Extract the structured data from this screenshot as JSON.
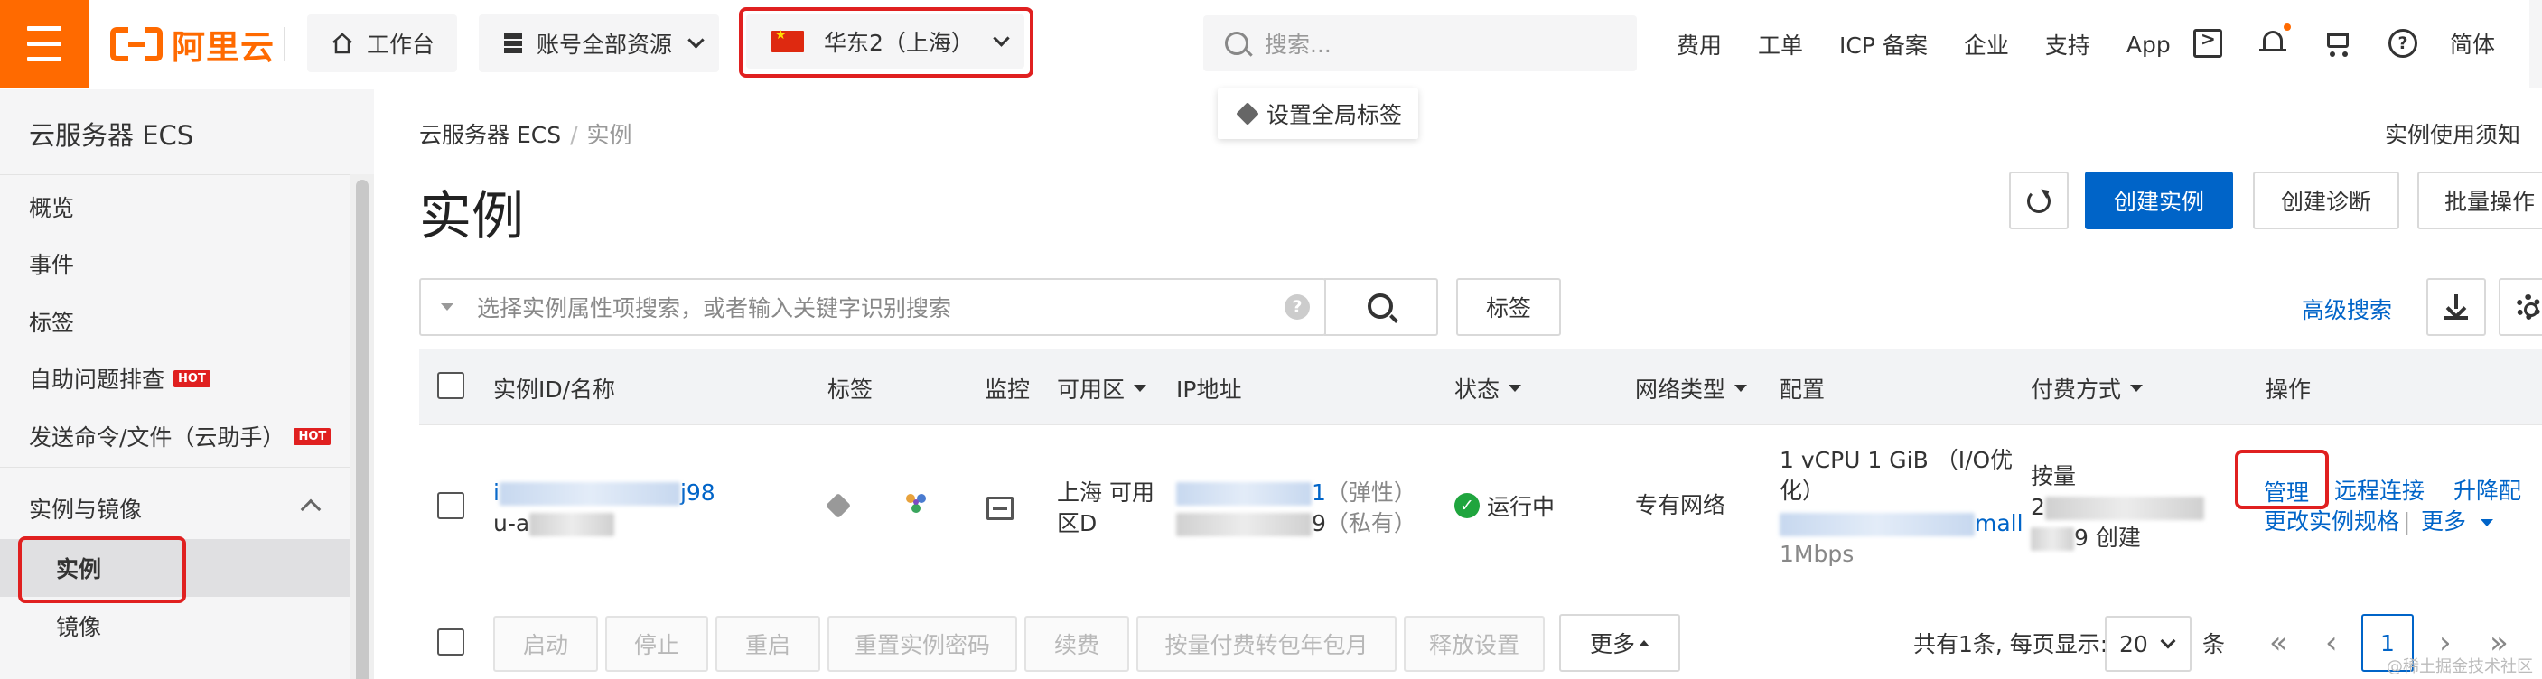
{
  "topbar": {
    "logo_text": "阿里云",
    "workbench": "工作台",
    "account_resources": "账号全部资源",
    "region": "华东2（上海）",
    "search_placeholder": "搜索...",
    "nav": [
      "费用",
      "工单",
      "ICP 备案",
      "企业",
      "支持",
      "App"
    ],
    "language": "简体"
  },
  "tooltip": {
    "set_global_tag": "设置全局标签"
  },
  "sidebar": {
    "title": "云服务器 ECS",
    "items": [
      {
        "label": "概览"
      },
      {
        "label": "事件"
      },
      {
        "label": "标签"
      },
      {
        "label": "自助问题排查",
        "badge": "HOT"
      },
      {
        "label": "发送命令/文件（云助手）",
        "badge": "HOT"
      }
    ],
    "group": "实例与镜像",
    "group_items": [
      "实例",
      "镜像"
    ]
  },
  "breadcrumb": {
    "root": "云服务器 ECS",
    "sep": "/",
    "current": "实例"
  },
  "notice": "实例使用须知",
  "page_title": "实例",
  "actions": {
    "create": "创建实例",
    "diagnose": "创建诊断",
    "batch": "批量操作"
  },
  "filter": {
    "placeholder": "选择实例属性项搜索，或者输入关键字识别搜索",
    "help": "?",
    "tag_button": "标签",
    "advanced_search": "高级搜索"
  },
  "table": {
    "headers": [
      "实例ID/名称",
      "标签",
      "监控",
      "可用区",
      "IP地址",
      "状态",
      "网络类型",
      "配置",
      "付费方式",
      "操作"
    ],
    "row": {
      "id_prefix": "i",
      "id_suffix": "j98",
      "name_prefix": "u-a",
      "zone_line1": "上海 可用",
      "zone_line2": "区D",
      "ip_public_suffix": "1",
      "ip_public_note": "（弹性）",
      "ip_private_suffix": "9",
      "ip_private_note": "（私有）",
      "status": "运行中",
      "network": "专有网络",
      "config_line1": "1 vCPU 1 GiB （I/O优",
      "config_line2": "化）",
      "config_type_suffix": "mall",
      "config_bw": "1Mbps",
      "pay_line1": "按量",
      "pay_line2_prefix": "2",
      "pay_line3_suffix": "9 创建",
      "ops": [
        "管理",
        "远程连接",
        "升降配",
        "更改实例规格",
        "更多"
      ]
    }
  },
  "footer": {
    "buttons": [
      "启动",
      "停止",
      "重启",
      "重置实例密码",
      "续费",
      "按量付费转包年包月",
      "释放设置"
    ],
    "more": "更多",
    "total": "共有1条, 每页显示:",
    "page_size": "20",
    "unit": "条",
    "current_page": "1"
  },
  "watermark": "@稀土掘金技术社区"
}
